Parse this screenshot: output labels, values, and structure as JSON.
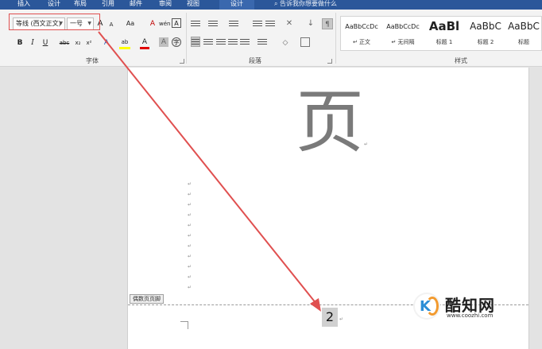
{
  "tabs": [
    {
      "label": "插入"
    },
    {
      "label": "设计"
    },
    {
      "label": "布局"
    },
    {
      "label": "引用"
    },
    {
      "label": "邮件"
    },
    {
      "label": "审阅"
    },
    {
      "label": "视图"
    },
    {
      "label": "设计",
      "active": true
    }
  ],
  "tell_me": "告诉我你想要做什么",
  "font_group": {
    "label": "字体",
    "font_name": "等线 (西文正文)",
    "font_size": "一号",
    "grow": "A",
    "shrink": "A",
    "change_case": "Aa",
    "clear_format": "A",
    "phonetic": "wén",
    "border_char": "A",
    "bold": "B",
    "italic": "I",
    "underline": "U",
    "strike": "abc",
    "subscript": "x₂",
    "superscript": "x²",
    "text_effect": "A",
    "highlight": "ab",
    "font_color": "A",
    "shading": "A",
    "enclose": "字"
  },
  "paragraph_group": {
    "label": "段落"
  },
  "styles_group": {
    "label": "样式",
    "items": [
      {
        "sample": "AaBbCcDc",
        "name": "↵ 正文"
      },
      {
        "sample": "AaBbCcDc",
        "name": "↵ 无间隔"
      },
      {
        "sample": "AaBl",
        "name": "标题 1"
      },
      {
        "sample": "AaBbC",
        "name": "标题 2"
      },
      {
        "sample": "AaBbC",
        "name": "标题"
      }
    ]
  },
  "document": {
    "big_char": "页",
    "footer_label": "偶数页页脚",
    "page_number": "2",
    "para_mark": "↵"
  },
  "watermark": {
    "name": "酷知网",
    "url": "www.coozhi.com"
  },
  "colors": {
    "accent": "#2b579a",
    "annotation": "#e05050"
  }
}
